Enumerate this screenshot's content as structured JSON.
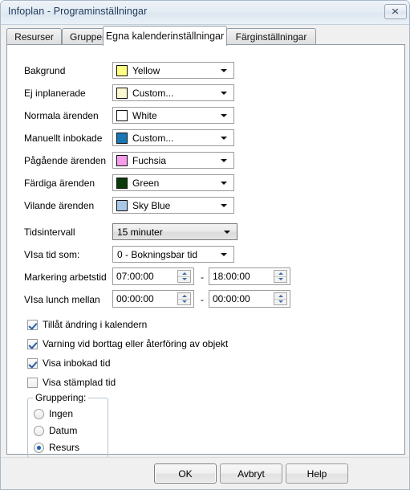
{
  "window": {
    "title": "Infoplan - Programinställningar",
    "close_label": "✕"
  },
  "tabs": [
    {
      "label": "Resurser",
      "selected": false
    },
    {
      "label": "Grupper",
      "selected": false
    },
    {
      "label": "Egna kalenderinställningar",
      "selected": true
    },
    {
      "label": "Färginställningar",
      "selected": false
    }
  ],
  "color_settings": [
    {
      "label": "Bakgrund",
      "value": "Yellow",
      "color": "#ffff80"
    },
    {
      "label": "Ej inplanerade",
      "value": "Custom...",
      "color": "#fbf8d2"
    },
    {
      "label": "Normala ärenden",
      "value": "White",
      "color": "#ffffff"
    },
    {
      "label": "Manuellt inbokade",
      "value": "Custom...",
      "color": "#1877b6"
    },
    {
      "label": "Pågående ärenden",
      "value": "Fuchsia",
      "color": "#f79ceb"
    },
    {
      "label": "Färdiga ärenden",
      "value": "Green",
      "color": "#0a3a09"
    },
    {
      "label": "Vilande ärenden",
      "value": "Sky Blue",
      "color": "#a8c8e8"
    }
  ],
  "interval": {
    "label": "Tidsintervall",
    "value": "15 minuter"
  },
  "show_time_as": {
    "label": "VIsa tid som:",
    "value": "0 - Bokningsbar tid"
  },
  "work_time": {
    "label": "Markering arbetstid",
    "from": "07:00:00",
    "to": "18:00:00",
    "separator": "-"
  },
  "lunch_time": {
    "label": "VIsa lunch mellan",
    "from": "00:00:00",
    "to": "00:00:00",
    "separator": "-"
  },
  "checkboxes": [
    {
      "label": "Tillåt ändring i kalendern",
      "checked": true
    },
    {
      "label": "Varning vid borttag eller återföring av objekt",
      "checked": true
    },
    {
      "label": "Visa inbokad tid",
      "checked": true
    },
    {
      "label": "Visa stämplad tid",
      "checked": false
    }
  ],
  "grouping": {
    "title": "Gruppering:",
    "options": [
      {
        "label": "Ingen",
        "selected": false
      },
      {
        "label": "Datum",
        "selected": false
      },
      {
        "label": "Resurs",
        "selected": true
      }
    ]
  },
  "footer": {
    "ok": "OK",
    "cancel": "Avbryt",
    "help": "Help"
  }
}
